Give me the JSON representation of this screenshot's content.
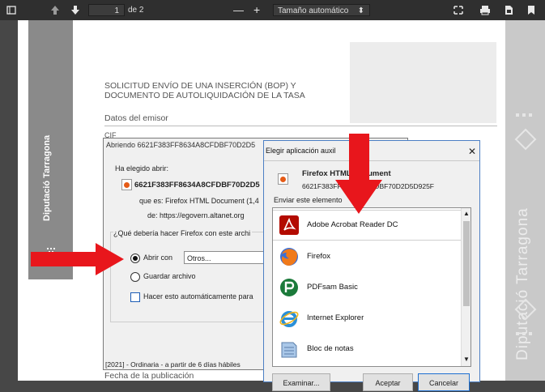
{
  "toolbar": {
    "page_number": "1",
    "page_of": "de 2",
    "zoom_label": "Tamaño automático",
    "zoom_minus": "—",
    "zoom_plus": "+"
  },
  "document": {
    "title_line1": "SOLICITUD ENVÍO DE UNA INSERCIÓN (BOP) Y",
    "title_line2": "DOCUMENTO DE AUTOLIQUIDACIÓN DE LA TASA",
    "section_emisor": "Datos del emisor",
    "cif_label": "CIF",
    "left_brand": "Diputació Tarragona",
    "right_brand": "Diputació Tarragona",
    "ordinaria": "[2021] - Ordinaria - a partir de 6 días hábiles",
    "fecha_label": "Fecha de la publicación"
  },
  "open_dialog": {
    "title": "Abriendo 6621F383FF8634A8CFDBF70D2D5",
    "chosen_to_open": "Ha elegido abrir:",
    "filename": "6621F383FF8634A8CFDBF70D2D5",
    "type_prefix": "que es:",
    "type_value": "Firefox HTML Document (1,4",
    "from_prefix": "de:",
    "from_value": "https://egovern.altanet.org",
    "question": "¿Qué debería hacer Firefox con este archi",
    "open_with_label": "Abrir con",
    "open_with_value": "Otros...",
    "save_label": "Guardar archivo",
    "auto_label": "Hacer esto automáticamente para"
  },
  "app_dialog": {
    "title": "Elegir aplicación auxil",
    "doc_type": "Firefox HTML Document",
    "doc_name": "6621F383FF8634A8CFDBF70D2D5D925F",
    "send_label": "Enviar este elemento",
    "apps": [
      {
        "name": "Adobe Acrobat Reader DC",
        "icon": "adobe-acrobat-icon"
      },
      {
        "name": "Firefox",
        "icon": "firefox-icon"
      },
      {
        "name": "PDFsam Basic",
        "icon": "pdfsam-icon"
      },
      {
        "name": "Internet Explorer",
        "icon": "internet-explorer-icon"
      },
      {
        "name": "Bloc de notas",
        "icon": "notepad-icon"
      }
    ],
    "buttons": {
      "browse": "Examinar...",
      "accept": "Aceptar",
      "cancel": "Cancelar"
    },
    "close_glyph": "✕"
  },
  "colors": {
    "arrow": "#e8161c",
    "toolbar": "#2f2f2f"
  }
}
